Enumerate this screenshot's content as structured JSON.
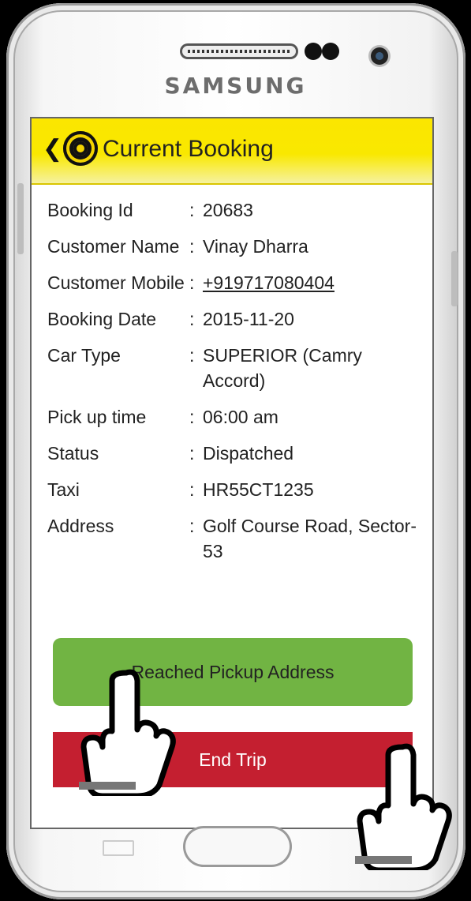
{
  "device": {
    "brand": "SAMSUNG"
  },
  "app_bar": {
    "title": "Current Booking"
  },
  "booking": {
    "rows": [
      {
        "label": "Booking Id",
        "value": "20683"
      },
      {
        "label": "Customer Name",
        "value": "Vinay Dharra"
      },
      {
        "label": "Customer Mobile",
        "value": "+919717080404"
      },
      {
        "label": "Booking Date",
        "value": "2015-11-20"
      },
      {
        "label": "Car Type",
        "value": "SUPERIOR (Camry Accord)"
      },
      {
        "label": "Pick up time",
        "value": "06:00 am"
      },
      {
        "label": "Status",
        "value": "Dispatched"
      },
      {
        "label": "Taxi",
        "value": "HR55CT1235"
      },
      {
        "label": "Address",
        "value": "Golf Course Road, Sector-53"
      }
    ],
    "colon": ":"
  },
  "actions": {
    "reached_pickup": "Reached Pickup Address",
    "end_trip": "End Trip"
  },
  "colors": {
    "appbar_yellow": "#fbe600",
    "reached_green": "#71b443",
    "end_trip_red": "#c41f30"
  },
  "icons": [
    "back-chevron-icon",
    "cab-logo-icon",
    "pointing-hand-icon"
  ]
}
